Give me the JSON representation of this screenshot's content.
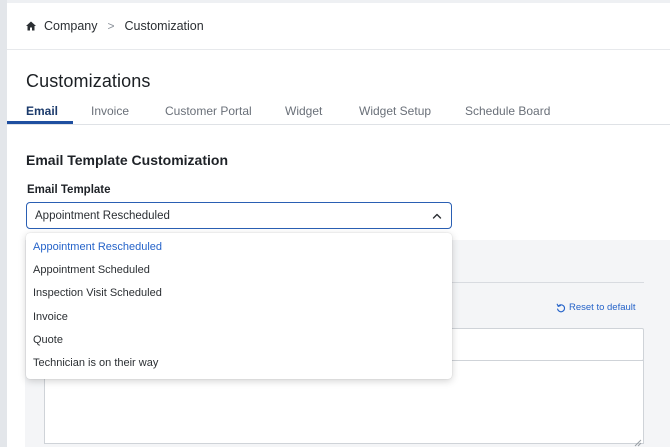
{
  "breadcrumb": {
    "home_label": "Company",
    "separator": ">",
    "current_label": "Customization"
  },
  "page": {
    "title": "Customizations"
  },
  "tabs": [
    {
      "label": "Email",
      "active": true
    },
    {
      "label": "Invoice",
      "active": false
    },
    {
      "label": "Customer Portal",
      "active": false
    },
    {
      "label": "Widget",
      "active": false
    },
    {
      "label": "Widget Setup",
      "active": false
    },
    {
      "label": "Schedule Board",
      "active": false
    }
  ],
  "email_section": {
    "title": "Email Template Customization",
    "template_label": "Email Template",
    "selected_template": "Appointment Rescheduled",
    "reset_label": "Reset to default"
  },
  "dropdown": {
    "options": [
      {
        "label": "Appointment Rescheduled",
        "selected": true
      },
      {
        "label": "Appointment Scheduled",
        "selected": false
      },
      {
        "label": "Inspection Visit Scheduled",
        "selected": false
      },
      {
        "label": "Invoice",
        "selected": false
      },
      {
        "label": "Quote",
        "selected": false
      },
      {
        "label": "Technician is on their way",
        "selected": false
      }
    ]
  },
  "icons": {
    "home": "home-icon",
    "breadcrumb_separator": "chevron-right-icon",
    "select_toggle": "chevron-up-icon",
    "reset": "reset-icon"
  },
  "colors": {
    "accent": "#1f4fa0",
    "link": "#2563c9",
    "active_tab_text": "#1b3a6b",
    "panel_background": "#f4f5f7"
  }
}
